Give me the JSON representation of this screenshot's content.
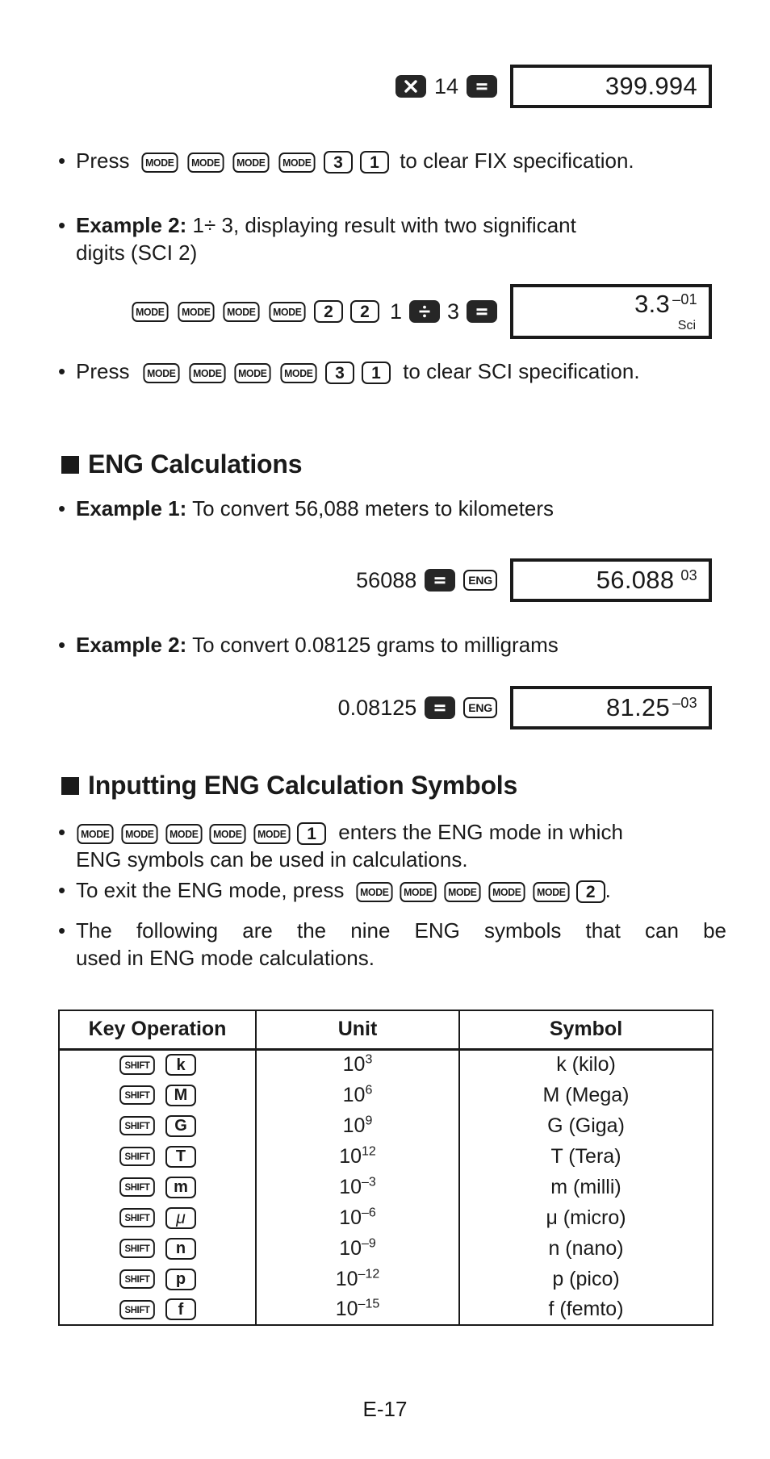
{
  "page": {
    "footer_label": "E-17"
  },
  "fix_example": {
    "ops": [
      "multiply-key",
      "14",
      "equals-key"
    ],
    "operand": "14",
    "display_value": "399.994"
  },
  "clear_fix": {
    "bullet": "•",
    "press_label": "Press",
    "keys": [
      "MODE",
      "MODE",
      "MODE",
      "MODE",
      "3",
      "1"
    ],
    "tail_label": "to clear FIX specification."
  },
  "sci_example": {
    "bullet": "•",
    "label": "Example 2:",
    "text_part1": "1",
    "divide_symbol": "÷",
    "text_part2": "3, displaying result with two significant",
    "text_line2": "digits (SCI 2)",
    "keys": [
      "MODE",
      "MODE",
      "MODE",
      "MODE",
      "2",
      "2"
    ],
    "operand1": "1",
    "operand2": "3",
    "display_value": "3.3",
    "display_exp": "–01",
    "display_mode": "Sci"
  },
  "clear_sci": {
    "bullet": "•",
    "press_label": "Press",
    "keys": [
      "MODE",
      "MODE",
      "MODE",
      "MODE",
      "3",
      "1"
    ],
    "tail_label": "to clear SCI specification."
  },
  "eng_calculations": {
    "heading": "ENG Calculations",
    "example1": {
      "bullet": "•",
      "label": "Example 1:",
      "text": "To convert 56,088 meters to kilometers",
      "operand": "56088",
      "eng_key": "ENG",
      "display_value": "56.088",
      "display_exp": "03"
    },
    "example2": {
      "bullet": "•",
      "label": "Example 2:",
      "text": "To convert 0.08125 grams to milligrams",
      "operand": "0.08125",
      "eng_key": "ENG",
      "display_value": "81.25",
      "display_exp": "–03"
    }
  },
  "inputting_symbols": {
    "heading": "Inputting ENG Calculation Symbols",
    "bullets": [
      {
        "bullet": "•",
        "keys": [
          "MODE",
          "MODE",
          "MODE",
          "MODE",
          "MODE",
          "1"
        ],
        "text_after": "enters the ENG mode in which",
        "text_line2": "ENG symbols can be used in calculations."
      },
      {
        "bullet": "•",
        "text_before": "To exit the ENG mode, press",
        "keys": [
          "MODE",
          "MODE",
          "MODE",
          "MODE",
          "MODE",
          "2"
        ],
        "text_after": "."
      },
      {
        "bullet": "•",
        "text_line1": "The following are the nine ENG symbols that can be",
        "text_line2": "used in ENG mode calculations."
      }
    ],
    "table": {
      "headers": [
        "Key Operation",
        "Unit",
        "Symbol"
      ],
      "rows": [
        {
          "shift": "SHIFT",
          "key": "k",
          "key_italic": false,
          "unit_base": "10",
          "unit_exp": "3",
          "symbol": "k (kilo)"
        },
        {
          "shift": "SHIFT",
          "key": "M",
          "key_italic": false,
          "unit_base": "10",
          "unit_exp": "6",
          "symbol": "M (Mega)"
        },
        {
          "shift": "SHIFT",
          "key": "G",
          "key_italic": false,
          "unit_base": "10",
          "unit_exp": "9",
          "symbol": "G (Giga)"
        },
        {
          "shift": "SHIFT",
          "key": "T",
          "key_italic": false,
          "unit_base": "10",
          "unit_exp": "12",
          "symbol": "T (Tera)"
        },
        {
          "shift": "SHIFT",
          "key": "m",
          "key_italic": false,
          "unit_base": "10",
          "unit_exp": "–3",
          "symbol": "m (milli)"
        },
        {
          "shift": "SHIFT",
          "key": "μ",
          "key_italic": true,
          "unit_base": "10",
          "unit_exp": "–6",
          "symbol": "μ (micro)"
        },
        {
          "shift": "SHIFT",
          "key": "n",
          "key_italic": false,
          "unit_base": "10",
          "unit_exp": "–9",
          "symbol": "n (nano)"
        },
        {
          "shift": "SHIFT",
          "key": "p",
          "key_italic": false,
          "unit_base": "10",
          "unit_exp": "–12",
          "symbol": "p (pico)"
        },
        {
          "shift": "SHIFT",
          "key": "f",
          "key_italic": false,
          "unit_base": "10",
          "unit_exp": "–15",
          "symbol": "f (femto)"
        }
      ]
    }
  }
}
